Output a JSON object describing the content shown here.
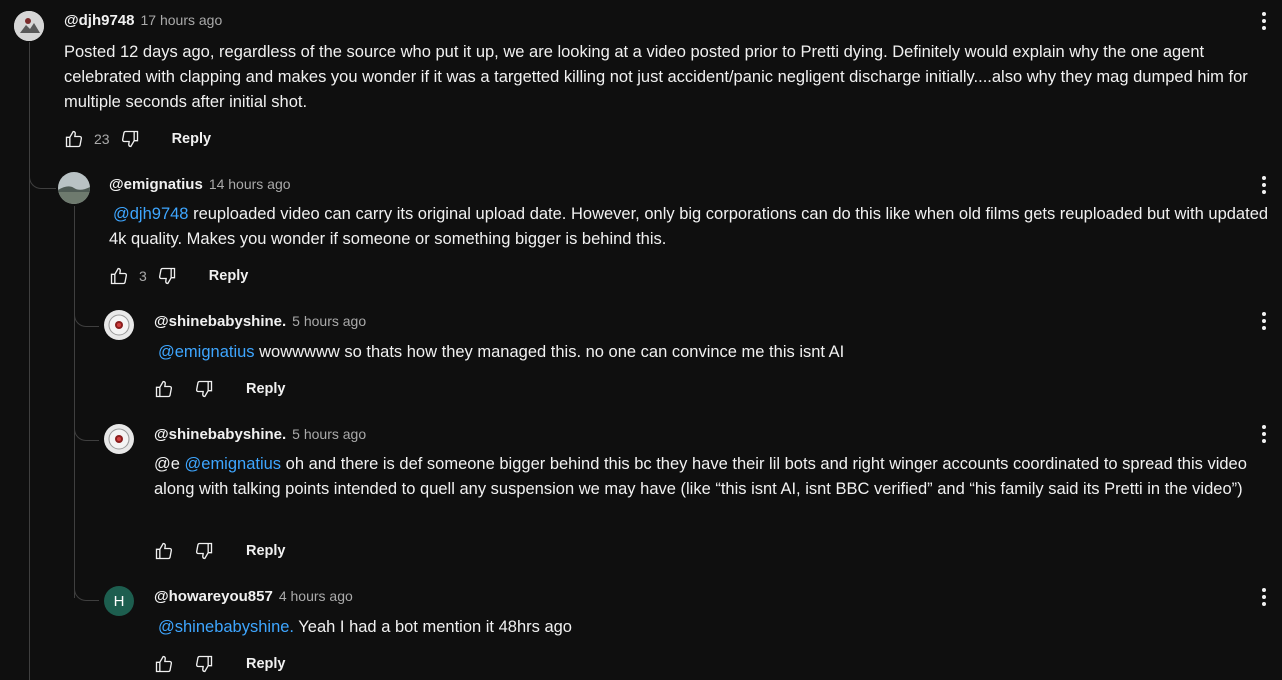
{
  "comments": [
    {
      "author": "@djh9748",
      "time": "17 hours ago",
      "text": "Posted 12 days ago, regardless of the source who put it up, we are looking at a video posted prior to Pretti dying.  Definitely would explain why the one agent celebrated with clapping and makes you wonder if it was a targetted killing not just accident/panic negligent discharge initially....also why they mag dumped him for multiple seconds after initial shot.",
      "likes": "23",
      "reply_label": "Reply"
    },
    {
      "author": "@emignatius",
      "time": "14 hours ago",
      "mention": "@djh9748",
      "text": " reuploaded video can carry its original upload date. However, only big corporations can do this like when old films gets reuploaded but with updated 4k quality. Makes you wonder if someone or something bigger is behind this.",
      "likes": "3",
      "reply_label": "Reply"
    },
    {
      "author": "@shinebabyshine.",
      "time": "5 hours ago",
      "mention": "@emignatius",
      "text": " wowwwww so thats how they managed this. no one can convince me this isnt AI",
      "reply_label": "Reply"
    },
    {
      "author": "@shinebabyshine.",
      "time": "5 hours ago",
      "prefix": "@e ",
      "mention": "@emignatius",
      "text": " oh and there is def someone bigger behind this bc they have their lil bots and right winger accounts coordinated to spread this video along with talking points intended to quell any suspension we may have (like “this isnt AI, isnt BBC verified” and “his family said its Pretti in the video”)",
      "reply_label": "Reply"
    },
    {
      "author": "@howareyou857",
      "time": "4 hours ago",
      "avatar_letter": "H",
      "avatar_color": "#1d5e4f",
      "mention": "@shinebabyshine.",
      "text": " Yeah I had a bot mention it 48hrs ago",
      "reply_label": "Reply"
    }
  ],
  "colors": {
    "mention": "#3ea6ff",
    "secondary_text": "#aaaaaa",
    "background": "#0f0f0f"
  },
  "icons": [
    "thumbs-up-icon",
    "thumbs-down-icon",
    "more-vert-icon"
  ]
}
